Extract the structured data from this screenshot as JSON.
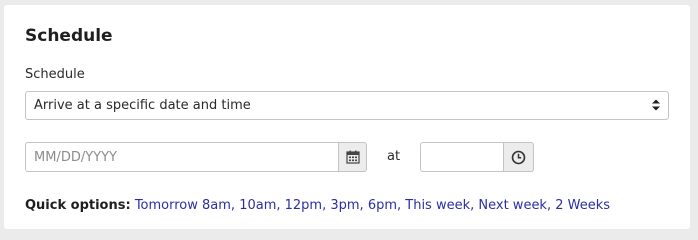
{
  "section": {
    "title": "Schedule"
  },
  "schedule_field": {
    "label": "Schedule",
    "selected": "Arrive at a specific date and time"
  },
  "date_field": {
    "placeholder": "MM/DD/YYYY",
    "value": "",
    "icon": "calendar-icon"
  },
  "at_label": "at",
  "time_field": {
    "placeholder": "",
    "value": "",
    "icon": "clock-icon"
  },
  "quick_options": {
    "label": "Quick options:",
    "links": [
      "Tomorrow 8am",
      "10am",
      "12pm",
      "3pm",
      "6pm",
      "This week",
      "Next week",
      "2 Weeks"
    ],
    "separator": ", "
  },
  "colors": {
    "link": "#2b2fa3",
    "background": "#ebebeb",
    "panel": "#ffffff",
    "button_bg": "#ececec"
  }
}
